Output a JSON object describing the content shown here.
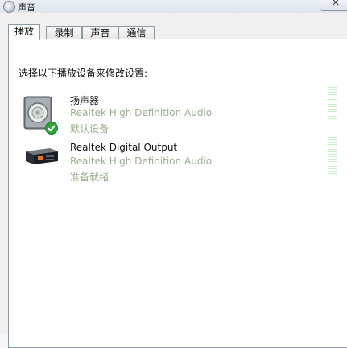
{
  "window": {
    "title": "声音",
    "close_glyph": "×"
  },
  "tabs": [
    {
      "label": "播放",
      "active": true
    },
    {
      "label": "录制",
      "active": false
    },
    {
      "label": "声音",
      "active": false
    },
    {
      "label": "通信",
      "active": false
    }
  ],
  "instruction": "选择以下播放设备来修改设置:",
  "devices": [
    {
      "name": "扬声器",
      "description": "Realtek High Definition Audio",
      "status": "默认设备",
      "icon": "speaker-icon",
      "is_default": true
    },
    {
      "name": "Realtek Digital Output",
      "description": "Realtek High Definition Audio",
      "status": "准备就绪",
      "icon": "digital-output-icon",
      "is_default": false
    }
  ],
  "colors": {
    "status_text": "#9ab090",
    "default_check": "#2ea33a",
    "level_meter": "#c9f0c6"
  }
}
